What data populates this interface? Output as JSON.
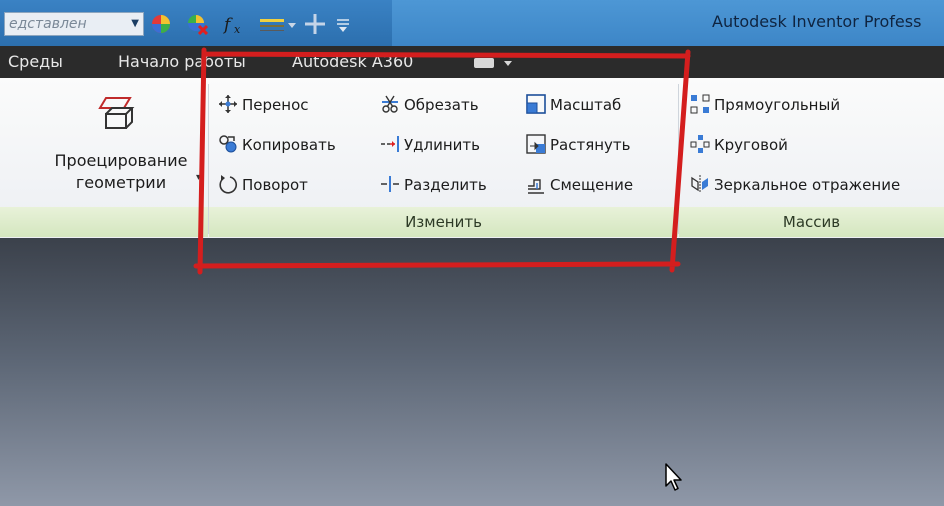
{
  "quick_access": {
    "combo_value": "едставлен",
    "icons": [
      "color-wheel-icon",
      "color-wheel-remove-icon",
      "function-fx-icon",
      "line-weight-icon",
      "cross-icon",
      "customize-icon"
    ]
  },
  "title": "Autodesk Inventor Profess",
  "tabs": [
    "Среды",
    "Начало работы",
    "Autodesk A360"
  ],
  "ribbon": {
    "projection": {
      "label_line1": "Проецирование",
      "label_line2": "геометрии"
    },
    "modify_panel": {
      "title": "Изменить",
      "tools": [
        {
          "label": "Перенос",
          "icon": "move-icon"
        },
        {
          "label": "Копировать",
          "icon": "copy-icon"
        },
        {
          "label": "Поворот",
          "icon": "rotate-icon"
        },
        {
          "label": "Обрезать",
          "icon": "trim-icon"
        },
        {
          "label": "Удлинить",
          "icon": "extend-icon"
        },
        {
          "label": "Разделить",
          "icon": "split-icon"
        },
        {
          "label": "Масштаб",
          "icon": "scale-icon"
        },
        {
          "label": "Растянуть",
          "icon": "stretch-icon"
        },
        {
          "label": "Смещение",
          "icon": "offset-icon"
        }
      ]
    },
    "pattern_panel": {
      "title": "Массив",
      "tools": [
        {
          "label": "Прямоугольный",
          "icon": "rectangular-pattern-icon"
        },
        {
          "label": "Круговой",
          "icon": "circular-pattern-icon"
        },
        {
          "label": "Зеркальное отражение",
          "icon": "mirror-icon"
        }
      ]
    }
  },
  "colors": {
    "accent_blue": "#2c6fae",
    "panel_green": "#d4e6bf",
    "annotation_red": "#d41e1e"
  }
}
